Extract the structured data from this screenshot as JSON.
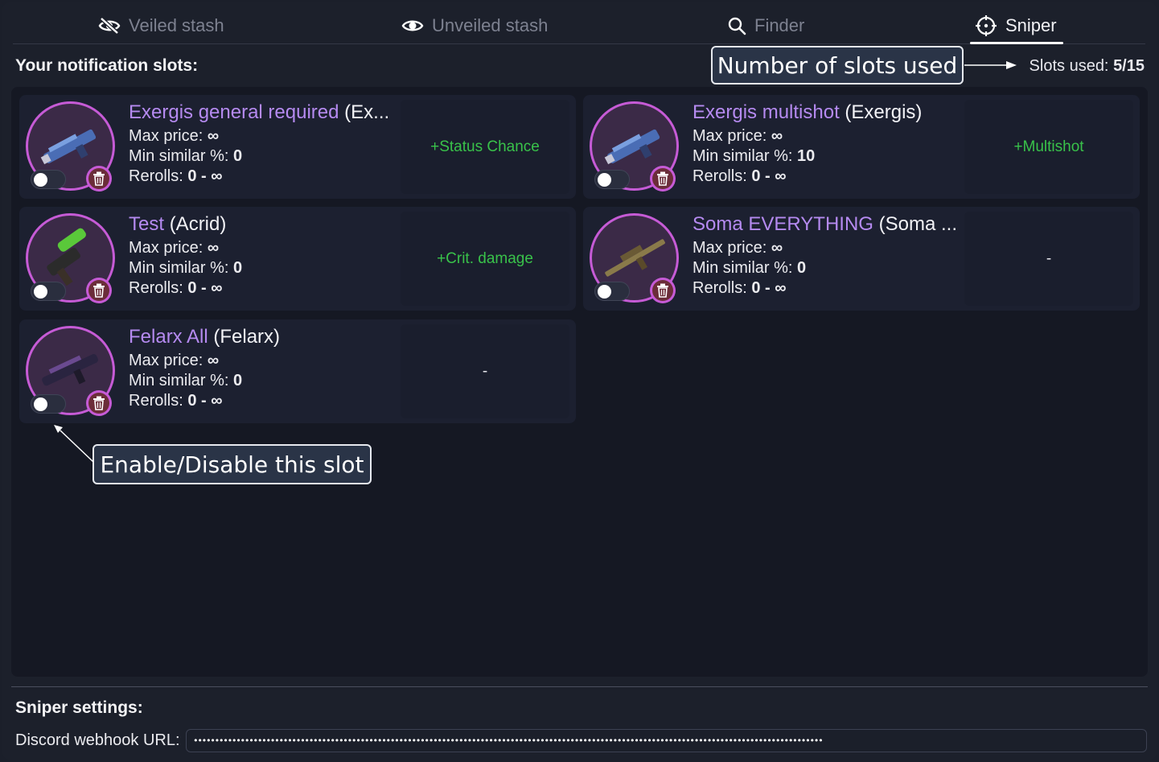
{
  "tabs": [
    {
      "label": "Veiled stash",
      "icon": "eye-slash-icon",
      "active": false
    },
    {
      "label": "Unveiled stash",
      "icon": "eye-icon",
      "active": false
    },
    {
      "label": "Finder",
      "icon": "search-icon",
      "active": false
    },
    {
      "label": "Sniper",
      "icon": "crosshair-icon",
      "active": true
    }
  ],
  "header": {
    "title": "Your notification slots:",
    "slots_used_label": "Slots used:",
    "slots_used_value": "5/15"
  },
  "slots": [
    {
      "name": "Exergis general required",
      "weapon": "(Ex...",
      "max_price_label": "Max price:",
      "max_price": "∞",
      "min_similar_label": "Min similar %:",
      "min_similar": "0",
      "rerolls_label": "Rerolls:",
      "rerolls": "0 - ∞",
      "stat": "+Status Chance",
      "enabled": false
    },
    {
      "name": "Exergis multishot",
      "weapon": "(Exergis)",
      "max_price_label": "Max price:",
      "max_price": "∞",
      "min_similar_label": "Min similar %:",
      "min_similar": "10",
      "rerolls_label": "Rerolls:",
      "rerolls": "0 - ∞",
      "stat": "+Multishot",
      "enabled": false
    },
    {
      "name": "Test",
      "weapon": "(Acrid)",
      "max_price_label": "Max price:",
      "max_price": "∞",
      "min_similar_label": "Min similar %:",
      "min_similar": "0",
      "rerolls_label": "Rerolls:",
      "rerolls": "0 - ∞",
      "stat": "+Crit. damage",
      "enabled": false
    },
    {
      "name": "Soma EVERYTHING",
      "weapon": "(Soma ...",
      "max_price_label": "Max price:",
      "max_price": "∞",
      "min_similar_label": "Min similar %:",
      "min_similar": "0",
      "rerolls_label": "Rerolls:",
      "rerolls": "0 - ∞",
      "stat": "-",
      "enabled": false
    },
    {
      "name": "Felarx All",
      "weapon": "(Felarx)",
      "max_price_label": "Max price:",
      "max_price": "∞",
      "min_similar_label": "Min similar %:",
      "min_similar": "0",
      "rerolls_label": "Rerolls:",
      "rerolls": "0 - ∞",
      "stat": "-",
      "enabled": false
    }
  ],
  "annotations": {
    "slots_used_callout": "Number of slots used",
    "toggle_callout": "Enable/Disable this slot"
  },
  "settings": {
    "title": "Sniper settings:",
    "webhook_label": "Discord webhook URL:",
    "webhook_value": "•••••••••••••••••••••••••••••••••••••••••••••••••••••••••••••••••••••••••••••••••••••••••••••••••••••••••••••••••••••••••••••••••••••••••••••••••••"
  },
  "colors": {
    "accent_purple": "#b58af0",
    "avatar_ring": "#c65bd6",
    "stat_green": "#39c24a",
    "background": "#1c202b"
  }
}
